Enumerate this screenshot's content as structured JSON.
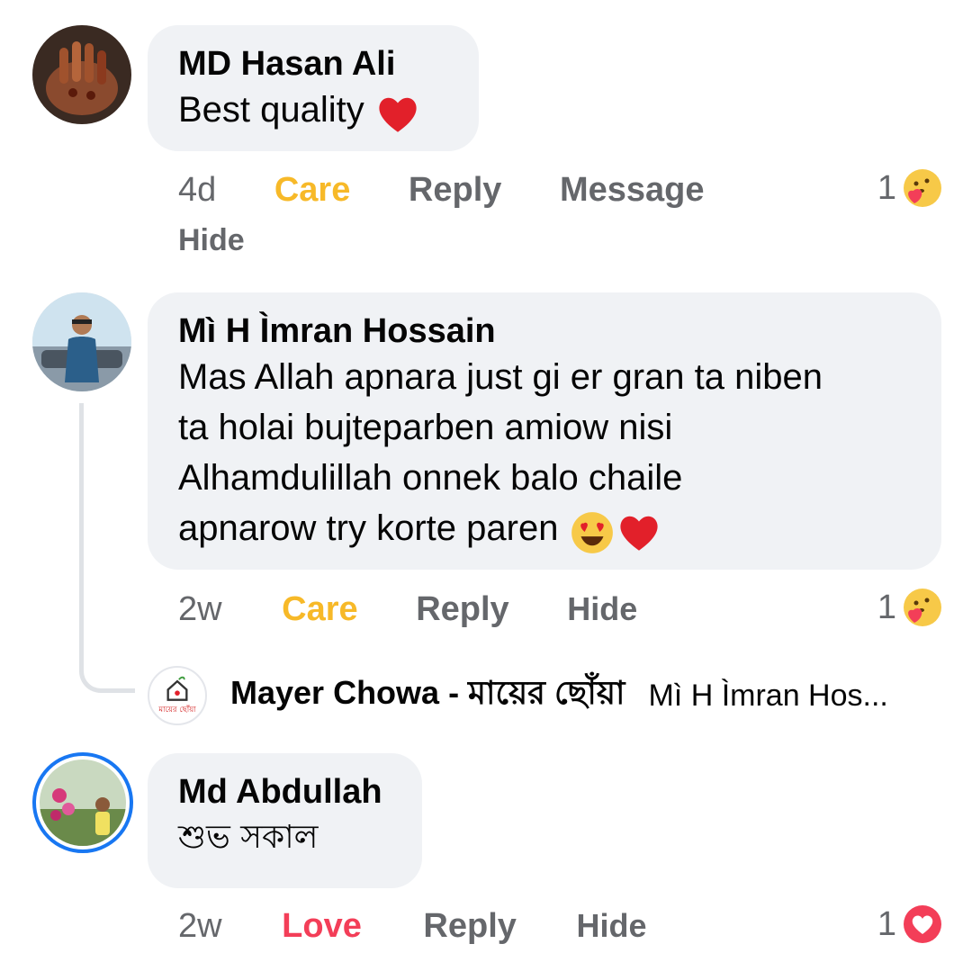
{
  "comments": [
    {
      "author": "MD Hasan Ali",
      "text": "Best quality",
      "time": "4d",
      "reaction_label": "Care",
      "actions": [
        "Reply",
        "Message",
        "Hide"
      ],
      "reaction_count": "1",
      "reaction_icon": "care-emoji-icon"
    },
    {
      "author": "Mì H Ìmran Hossain",
      "text_lines": [
        "Mas Allah apnara just gi er gran ta niben",
        "ta holai bujteparben amiow nisi",
        "Alhamdulillah onnek balo chaile",
        "apnarow try korte paren"
      ],
      "time": "2w",
      "reaction_label": "Care",
      "actions": [
        "Reply",
        "Hide"
      ],
      "reaction_count": "1",
      "reaction_icon": "care-emoji-icon"
    },
    {
      "author": "Md Abdullah",
      "text": "শুভ সকাল",
      "time": "2w",
      "reaction_label": "Love",
      "actions": [
        "Reply",
        "Hide"
      ],
      "reaction_count": "1",
      "reaction_icon": "love-heart-icon"
    }
  ],
  "reply_preview": {
    "page_name": "Mayer Chowa - মায়ের ছোঁয়া",
    "reply_to": "Mì H Ìmran Hos...",
    "logo_text": "মায়ের ছোঁয়া"
  },
  "colors": {
    "care": "#f7b928",
    "love": "#f33e58",
    "bubble": "#f0f2f5",
    "meta": "#65676b",
    "story_ring": "#1877f2"
  }
}
